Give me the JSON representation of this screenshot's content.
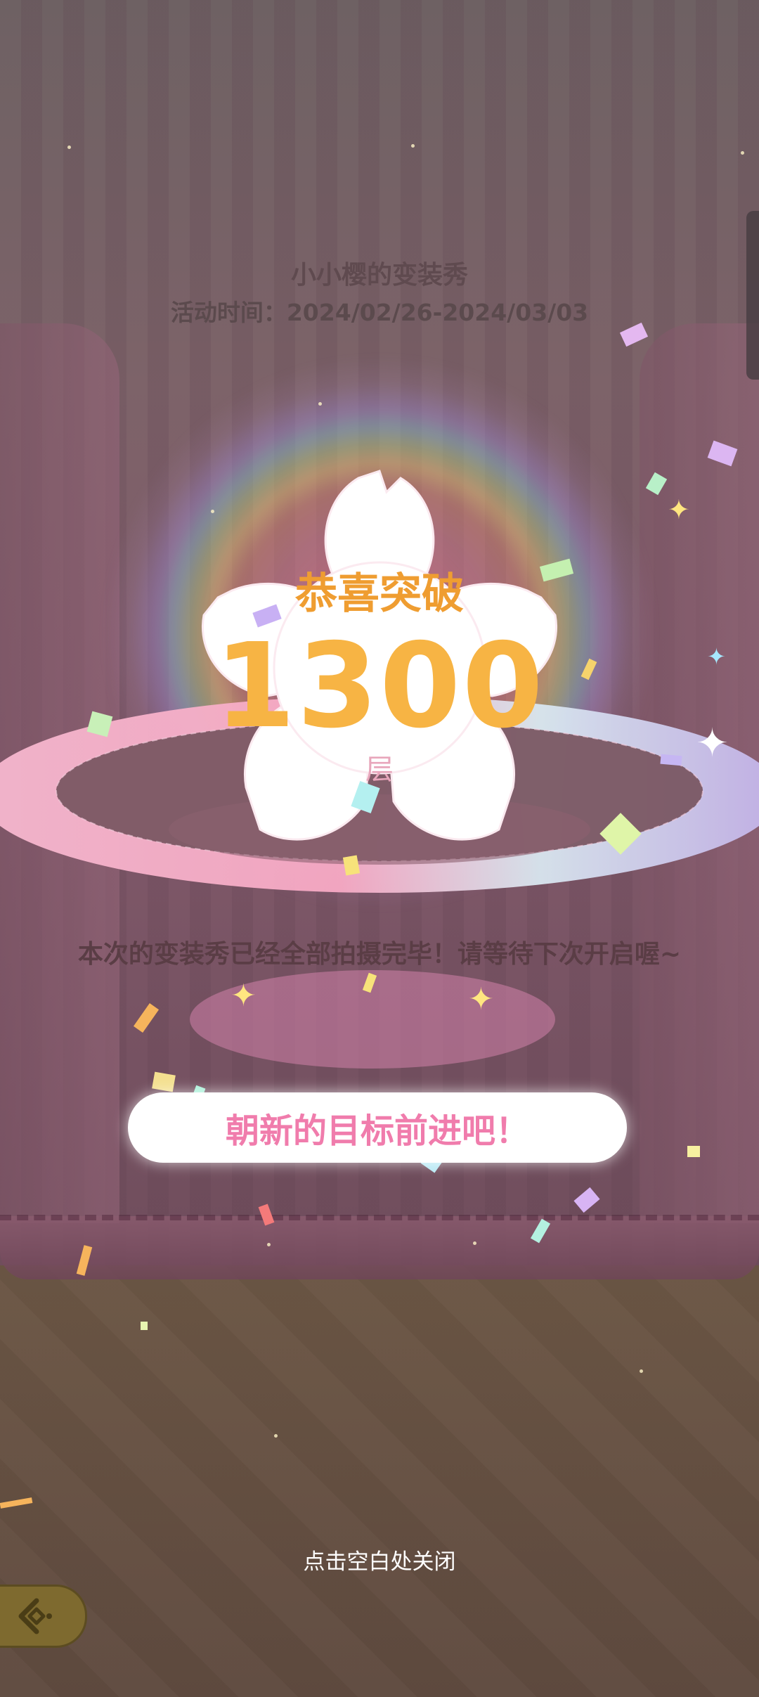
{
  "event": {
    "title": "小小樱的变装秀",
    "date_range": "活动时间：2024/02/26-2024/03/03"
  },
  "milestone": {
    "congrats_label": "恭喜突破",
    "floor_number": "1300",
    "unit": "层"
  },
  "message": "本次的变装秀已经全部拍摄完毕！请等待下次开启喔~",
  "cta_button_label": "朝新的目标前进吧！",
  "close_hint": "点击空白处关闭",
  "icons": {
    "back": "back-arrow-icon",
    "flower": "sakura-flower-icon",
    "sparkle": "sparkle-icon"
  },
  "colors": {
    "accent_orange": "#f7b444",
    "accent_pink": "#f07cac",
    "back_button": "#7e6a2f"
  }
}
